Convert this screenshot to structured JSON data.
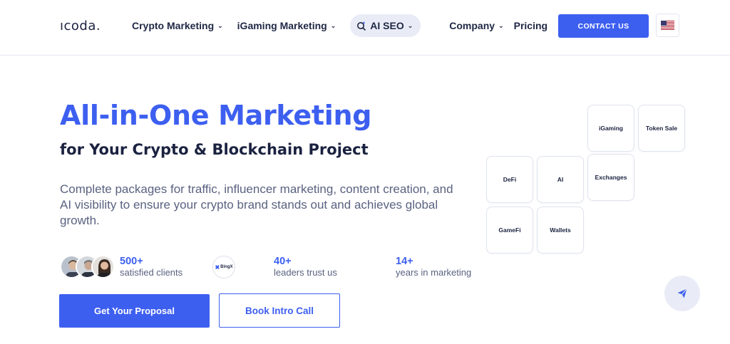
{
  "header": {
    "logo": "ıcoda.",
    "nav": [
      {
        "label": "Crypto Marketing",
        "has_dropdown": true
      },
      {
        "label": "iGaming Marketing",
        "has_dropdown": true
      },
      {
        "label": "AI SEO",
        "has_dropdown": true,
        "highlighted": true,
        "icon": "sparkle-search-icon"
      },
      {
        "label": "Company",
        "has_dropdown": true
      },
      {
        "label": "Pricing",
        "has_dropdown": false
      }
    ],
    "contact_label": "CONTACT US",
    "language_icon": "us-flag-icon"
  },
  "hero": {
    "title": "All-in-One Marketing",
    "subtitle": "for Your Crypto & Blockchain Project",
    "description": "Complete packages for traffic, influencer marketing, content creation, and AI visibility to ensure your crypto brand stands out and achieves global growth."
  },
  "stats": [
    {
      "number": "500+",
      "label": "satisfied clients"
    },
    {
      "number": "40+",
      "label": "leaders trust us"
    },
    {
      "number": "14+",
      "label": "years in marketing"
    }
  ],
  "partner_badge": "BingX",
  "buttons": {
    "primary": "Get Your Proposal",
    "secondary": "Book Intro Call"
  },
  "tiles": [
    "iGaming",
    "Token Sale",
    "DeFi",
    "AI",
    "Exchanges",
    "GameFi",
    "Wallets"
  ],
  "colors": {
    "accent": "#3d5ff0",
    "text_dark": "#1b2240",
    "text_muted": "#5a6280",
    "pill_bg": "#e9ecf6"
  },
  "chat_icon": "send-icon"
}
